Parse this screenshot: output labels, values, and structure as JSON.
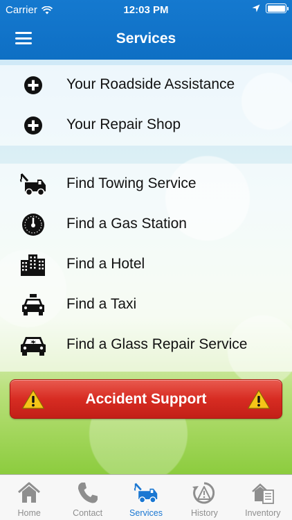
{
  "status_bar": {
    "carrier": "Carrier",
    "time": "12:03 PM"
  },
  "nav": {
    "title": "Services"
  },
  "services_primary": [
    {
      "label": "Your Roadside Assistance",
      "icon": "plus-circle-icon"
    },
    {
      "label": "Your Repair Shop",
      "icon": "plus-circle-icon"
    }
  ],
  "services_find": [
    {
      "label": "Find Towing Service",
      "icon": "tow-truck-icon"
    },
    {
      "label": "Find a Gas Station",
      "icon": "gauge-icon"
    },
    {
      "label": "Find a Hotel",
      "icon": "buildings-icon"
    },
    {
      "label": "Find a Taxi",
      "icon": "taxi-icon"
    },
    {
      "label": "Find a Glass Repair Service",
      "icon": "car-glass-icon"
    }
  ],
  "accident_button": {
    "label": "Accident Support",
    "icon": "warning-icon"
  },
  "tabs": [
    {
      "label": "Home",
      "icon": "home-icon",
      "active": false
    },
    {
      "label": "Contact",
      "icon": "phone-icon",
      "active": false
    },
    {
      "label": "Services",
      "icon": "tow-truck-icon",
      "active": true
    },
    {
      "label": "History",
      "icon": "history-icon",
      "active": false
    },
    {
      "label": "Inventory",
      "icon": "inventory-icon",
      "active": false
    }
  ],
  "colors": {
    "header_blue": "#1579cf",
    "accident_red": "#d72c22",
    "tab_active": "#1a77d2",
    "tab_inactive": "#8e8e8e",
    "warning_yellow": "#f5c518"
  }
}
